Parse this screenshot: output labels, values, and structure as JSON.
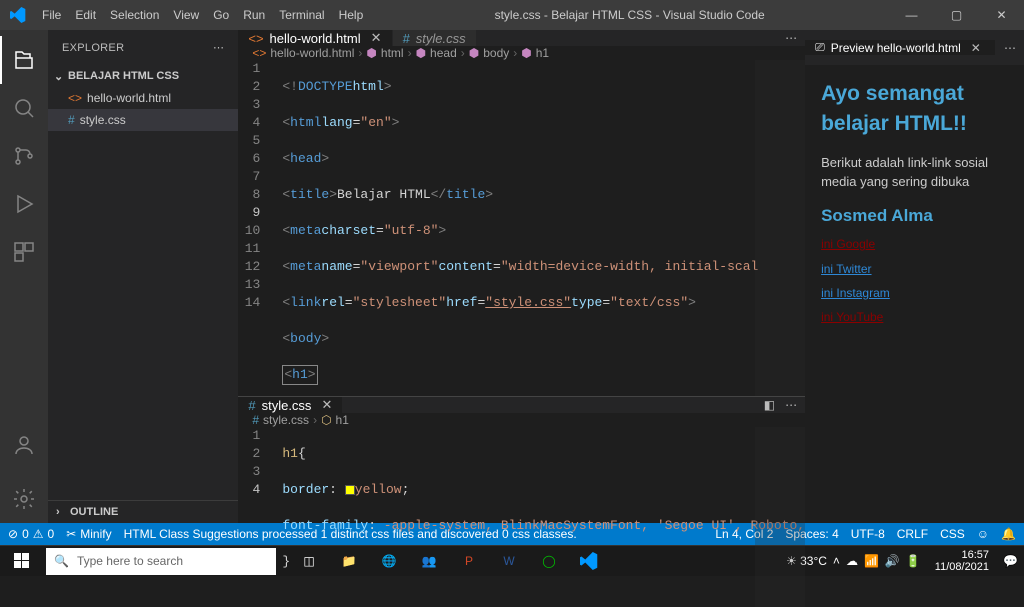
{
  "title": "style.css - Belajar HTML CSS - Visual Studio Code",
  "menu": [
    "File",
    "Edit",
    "Selection",
    "View",
    "Go",
    "Run",
    "Terminal",
    "Help"
  ],
  "sidebar": {
    "title": "EXPLORER",
    "project": "BELAJAR HTML CSS",
    "files": [
      {
        "name": "hello-world.html",
        "icon": "html"
      },
      {
        "name": "style.css",
        "icon": "css",
        "active": true
      }
    ],
    "outline": "OUTLINE"
  },
  "tabs_top": [
    {
      "label": "hello-world.html",
      "icon": "html",
      "active": true,
      "close": true
    },
    {
      "label": "style.css",
      "icon": "css",
      "italic": true
    }
  ],
  "tabs_bot": [
    {
      "label": "style.css",
      "icon": "css",
      "active": true,
      "close": true
    }
  ],
  "preview_tab": {
    "label": "Preview hello-world.html",
    "close": true
  },
  "breadcrumb_top": [
    "hello-world.html",
    "html",
    "head",
    "body",
    "h1"
  ],
  "breadcrumb_bot": [
    "style.css",
    "h1"
  ],
  "code_top_lines": [
    "1",
    "2",
    "3",
    "4",
    "5",
    "6",
    "7",
    "8",
    "9",
    "10",
    "11",
    "12",
    "13",
    "14"
  ],
  "code_bot_lines": [
    "1",
    "2",
    "3",
    "4"
  ],
  "preview": {
    "h1": "Ayo semangat belajar HTML!!",
    "para": "Berikut adalah link-link sosial media yang sering dibuka",
    "h3": "Sosmed Alma",
    "links": [
      "ini Google",
      "ini Twitter",
      "ini Instagram",
      "ini YouTube"
    ]
  },
  "status_left": {
    "errors": "0",
    "warnings": "0",
    "minify": "Minify",
    "msg": "HTML Class Suggestions processed 1 distinct css files and discovered 0 css classes."
  },
  "status_right": {
    "pos": "Ln 4, Col 2",
    "spaces": "Spaces: 4",
    "enc": "UTF-8",
    "eol": "CRLF",
    "lang": "CSS"
  },
  "taskbar": {
    "search_placeholder": "Type here to search",
    "weather": "33°C",
    "time": "16:57",
    "date": "11/08/2021"
  }
}
